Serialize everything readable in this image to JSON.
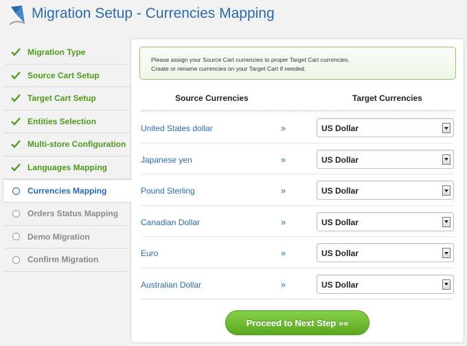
{
  "header": {
    "title": "Migration Setup - Currencies Mapping"
  },
  "sidebar": {
    "steps": [
      {
        "label": "Migration Type",
        "state": "done"
      },
      {
        "label": "Source Cart Setup",
        "state": "done"
      },
      {
        "label": "Target Cart Setup",
        "state": "done"
      },
      {
        "label": "Entities Selection",
        "state": "done"
      },
      {
        "label": "Multi-store Configuration",
        "state": "done"
      },
      {
        "label": "Languages Mapping",
        "state": "done"
      },
      {
        "label": "Currencies Mapping",
        "state": "active"
      },
      {
        "label": "Orders Status Mapping",
        "state": "pending"
      },
      {
        "label": "Demo Migration",
        "state": "pending"
      },
      {
        "label": "Confirm Migration",
        "state": "pending"
      }
    ]
  },
  "notice": {
    "line1": "Please assign your Source Cart currencies to proper Target Cart currencies.",
    "line2": "Create or rename currencies on your Target Cart if needed."
  },
  "mapping": {
    "source_header": "Source Currencies",
    "target_header": "Target Currencies",
    "arrow": "»",
    "rows": [
      {
        "source": "United States dollar",
        "target": "US Dollar"
      },
      {
        "source": "Japanese yen",
        "target": "US Dollar"
      },
      {
        "source": "Pound Sterling",
        "target": "US Dollar"
      },
      {
        "source": "Canadian Dollar",
        "target": "US Dollar"
      },
      {
        "source": "Euro",
        "target": "US Dollar"
      },
      {
        "source": "Australian Dollar",
        "target": "US Dollar"
      }
    ]
  },
  "actions": {
    "proceed_label": "Proceed to Next Step »»"
  },
  "colors": {
    "accent_blue": "#2b6aa8",
    "done_green": "#4f9a1a",
    "button_green": "#6cbb30"
  }
}
